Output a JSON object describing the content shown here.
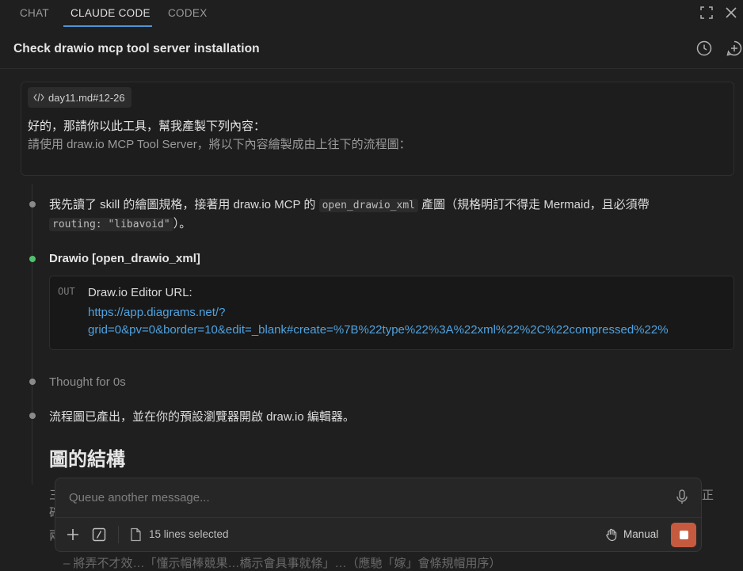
{
  "tabs": [
    {
      "label": "CHAT",
      "active": false
    },
    {
      "label": "CLAUDE CODE",
      "active": true
    },
    {
      "label": "CODEX",
      "active": false
    }
  ],
  "header": {
    "title": "Check drawio mcp tool server installation"
  },
  "message": {
    "file_chip": "day11.md#12-26",
    "line1": "好的，那請你以此工具，幫我產製下列內容：",
    "line2": "請使用 draw.io MCP Tool Server，將以下內容繪製成由上往下的流程圖："
  },
  "timeline": {
    "step1": {
      "pre": "我先讀了 skill 的繪圖規格，接著用 draw.io MCP 的 ",
      "code1": "open_drawio_xml",
      "mid": " 產圖（規格明訂不得走 Mermaid，且必須帶",
      "code2": "routing: \"libavoid\"",
      "post": "）。"
    },
    "tool_call": "Drawio [open_drawio_xml]",
    "output": {
      "tag": "OUT",
      "line1": "Draw.io Editor URL:",
      "line2": "https://app.diagrams.net/?",
      "line3": "grid=0&pv=0&border=10&edit=_blank#create=%7B%22type%22%3A%22xml%22%2C%22compressed%22%"
    },
    "thought": "Thought for 0s",
    "result": "流程圖已產出，並在你的預設瀏覽器開啟 draw.io 編輯器。",
    "heading": "圖的結構"
  },
  "composer": {
    "placeholder": "Queue another message...",
    "selection": "15 lines selected",
    "mode": "Manual"
  },
  "colors": {
    "background": "#1f1f1f",
    "accent_tab": "#4f95d6",
    "link": "#4fa3e0",
    "active_dot": "#4ec26b",
    "stop_button": "#c65a3f"
  }
}
